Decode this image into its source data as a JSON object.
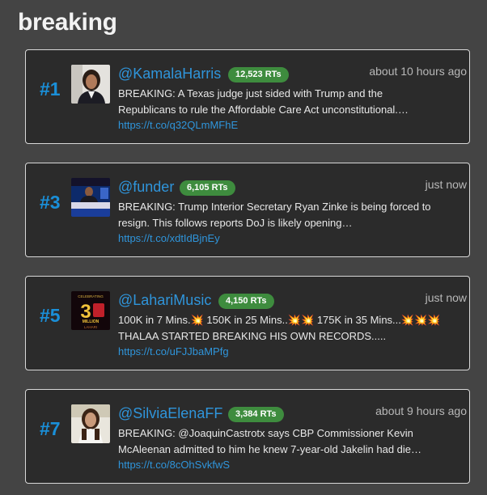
{
  "page": {
    "title": "breaking"
  },
  "tweets": [
    {
      "rank": "#1",
      "handle": "@KamalaHarris",
      "retweets": "12,523 RTs",
      "time": "about 10 hours ago",
      "line1": "BREAKING: A Texas judge just sided with Trump and the",
      "line2": "Republicans to rule the Affordable Care Act unconstitutional.…",
      "link": "https://t.co/q32QLmMFhE"
    },
    {
      "rank": "#3",
      "handle": "@funder",
      "retweets": "6,105 RTs",
      "time": "just now",
      "line1": "BREAKING: Trump Interior Secretary Ryan Zinke is being forced to",
      "line2": "resign. This follows reports DoJ is likely opening…",
      "link": "https://t.co/xdtIdBjnEy"
    },
    {
      "rank": "#5",
      "handle": "@LahariMusic",
      "retweets": "4,150 RTs",
      "time": "just now",
      "line1": "100K in 7 Mins.💥 150K in 25 Mins..💥💥 175K in 35 Mins...💥💥💥",
      "line2": "THALAA STARTED BREAKING HIS OWN RECORDS.....",
      "link": "https://t.co/uFJJbaMPfg",
      "avatar_text": {
        "top": "CELEBRATING",
        "number": "3",
        "bottom": "MILLION",
        "brand": "LAHARI"
      }
    },
    {
      "rank": "#7",
      "handle": "@SilviaElenaFF",
      "retweets": "3,384 RTs",
      "time": "about 9 hours ago",
      "line1": "BREAKING: @JoaquinCastrotx says CBP Commissioner Kevin",
      "line2": "McAleenan admitted to him he knew 7-year-old Jakelin had die…",
      "link": "https://t.co/8cOhSvkfwS"
    }
  ],
  "colors": {
    "background": "#444444",
    "card": "#2b2b2b",
    "accent_blue": "#2f95db",
    "rank_blue": "#1a8fd8",
    "badge_green": "#3e8c3e"
  }
}
